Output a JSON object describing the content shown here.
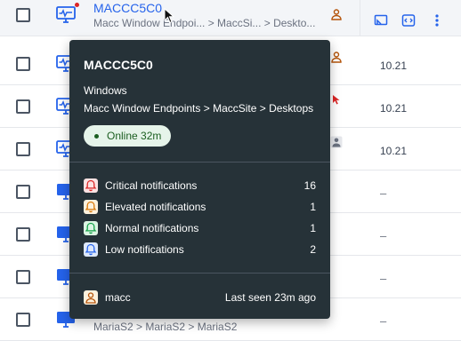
{
  "rows": [
    {
      "name": "MACCC5C0",
      "path": "Macc Window Endpoi...  > MaccSi...  > Deskto...",
      "value": ""
    },
    {
      "name": "",
      "path": "",
      "value": "10.21"
    },
    {
      "name": "",
      "path": "",
      "value": "10.21"
    },
    {
      "name": "",
      "path": "",
      "value": "10.21"
    },
    {
      "name": "",
      "path": "",
      "value": "–"
    },
    {
      "name": "",
      "path": "",
      "value": "–"
    },
    {
      "name": "",
      "path": "",
      "value": "–"
    },
    {
      "name": "",
      "path": "MariaS2 > MariaS2 > MariaS2",
      "value": "–"
    }
  ],
  "tooltip": {
    "title": "MACCC5C0",
    "os": "Windows",
    "path": "Macc Window Endpoints > MaccSite > Desktops",
    "status": "Online 32m",
    "notifications": [
      {
        "label": "Critical notifications",
        "count": "16",
        "icon": "bell-critical-icon"
      },
      {
        "label": "Elevated notifications",
        "count": "1",
        "icon": "bell-elevated-icon"
      },
      {
        "label": "Normal notifications",
        "count": "1",
        "icon": "bell-normal-icon"
      },
      {
        "label": "Low notifications",
        "count": "2",
        "icon": "bell-low-icon"
      }
    ],
    "user": "macc",
    "last_seen": "Last seen 23m ago"
  },
  "colors": {
    "accent": "#2563eb",
    "tooltip_bg": "#263238",
    "online": "#1b5e20",
    "critical": "#dc2626",
    "elevated": "#f59e0b",
    "normal": "#16a34a",
    "low": "#2563eb"
  }
}
